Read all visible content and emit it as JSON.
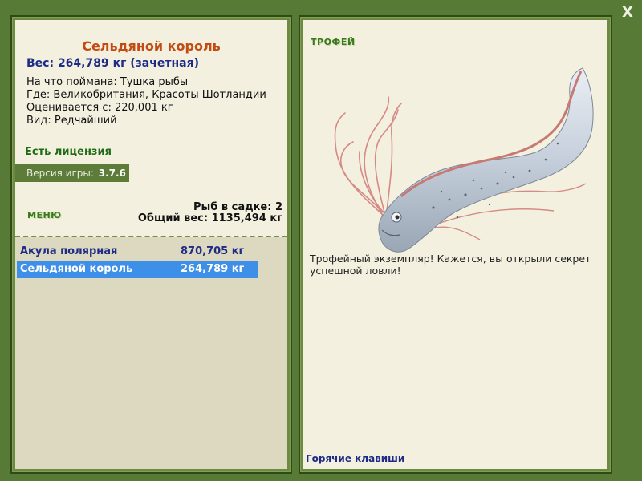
{
  "window": {
    "close_label": "X"
  },
  "fish": {
    "title": "Сельдяной король",
    "weight_line": "Вес: 264,789 кг (зачетная)",
    "info": [
      "На что поймана: Тушка рыбы",
      "Где: Великобритания, Красоты Шотландии",
      "Оценивается с: 220,001 кг",
      "Вид: Редчайший"
    ]
  },
  "license": {
    "label": "Есть лицензия"
  },
  "version": {
    "label": "Версия игры:",
    "value": "3.7.6"
  },
  "menu": {
    "label": "МЕНЮ"
  },
  "cage": {
    "count_line": "Рыб в садке: 2",
    "total_line": "Общий вес: 1135,494 кг"
  },
  "catches": [
    {
      "name": "Акула полярная",
      "weight": "870,705 кг",
      "selected": false
    },
    {
      "name": "Сельдяной король",
      "weight": "264,789 кг",
      "selected": true
    }
  ],
  "trophy": {
    "label": "ТРОФЕЙ",
    "description": "Трофейный экземпляр! Кажется, вы открыли секрет успешной ловли!",
    "image_icon": "oarfish-image"
  },
  "footer": {
    "hotkeys_label": "Горячие клавиши"
  },
  "colors": {
    "background": "#587a37",
    "panel": "#f3f0e0",
    "title": "#c14b12",
    "weight": "#1d2a86",
    "license": "#1e6b13",
    "selection": "#3d8fe8"
  }
}
